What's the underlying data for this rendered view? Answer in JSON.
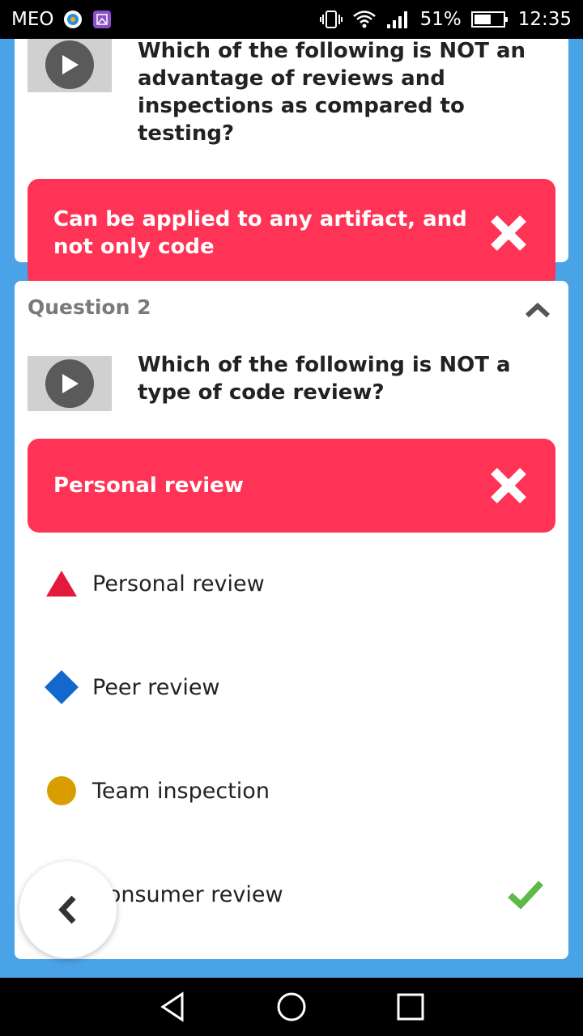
{
  "status_bar": {
    "carrier": "MEO",
    "battery_percent": "51%",
    "time": "12:35"
  },
  "card1": {
    "question": "Which of the following is NOT an advantage of reviews and inspections as compared to testing?",
    "selected_answer": "Can be applied to any artifact, and not only code"
  },
  "card2": {
    "title": "Question 2",
    "question": "Which of the following is NOT a type of code review?",
    "selected_answer": "Personal review",
    "options": [
      {
        "label": "Personal review",
        "shape": "triangle",
        "color": "#e21b3c"
      },
      {
        "label": "Peer review",
        "shape": "diamond",
        "color": "#1368ce"
      },
      {
        "label": "Team inspection",
        "shape": "circle",
        "color": "#d89e00"
      },
      {
        "label": "Consumer review",
        "shape": "square",
        "color": "#26890c",
        "correct": true
      }
    ]
  },
  "colors": {
    "wrong_answer_bg": "#ff3355",
    "correct_check": "#5cba47",
    "background": "#4aa3e6"
  }
}
